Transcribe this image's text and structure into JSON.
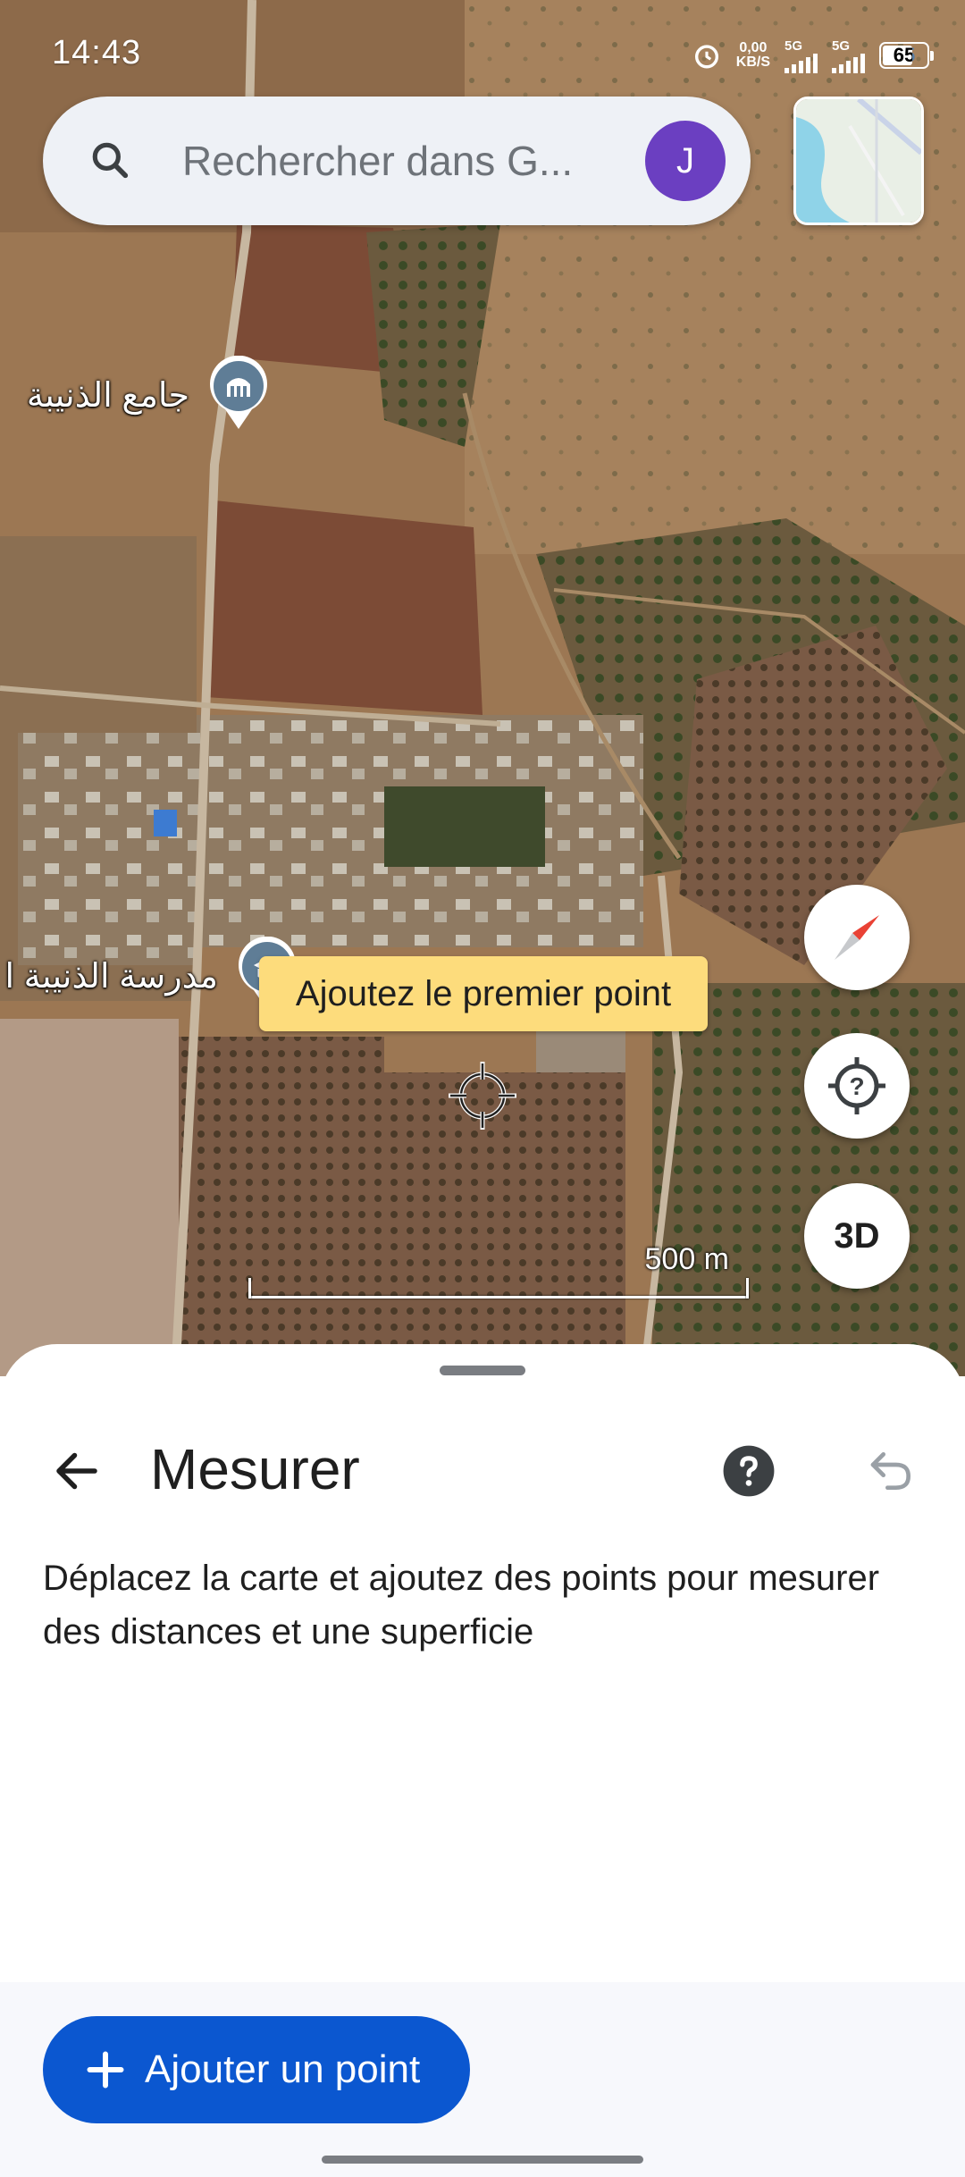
{
  "status_bar": {
    "time": "14:43",
    "net_speed_value": "0,00",
    "net_speed_unit": "KB/S",
    "network_1": "5G",
    "network_2": "5G",
    "battery": "65"
  },
  "search": {
    "placeholder": "Rechercher dans G...",
    "avatar_initial": "J"
  },
  "map": {
    "pois": [
      {
        "label": "جامع الذنيبة",
        "icon": "mosque-icon"
      },
      {
        "label": "مدرسة الذنيبة ا",
        "icon": "school-icon"
      }
    ],
    "tooltip": "Ajoutez le premier point",
    "scale_label": "500 m",
    "buttons": {
      "compass": "compass-icon",
      "my_location": "my-location-icon",
      "three_d": "3D"
    }
  },
  "sheet": {
    "title": "Mesurer",
    "description": "Déplacez la carte et ajoutez des points pour mesurer des distances et une superficie",
    "add_point_label": "Ajouter un point"
  },
  "colors": {
    "primary": "#0b57d0",
    "avatar": "#6b3fc1",
    "tooltip": "#fddc7c",
    "search_bg": "#eef1f6"
  }
}
